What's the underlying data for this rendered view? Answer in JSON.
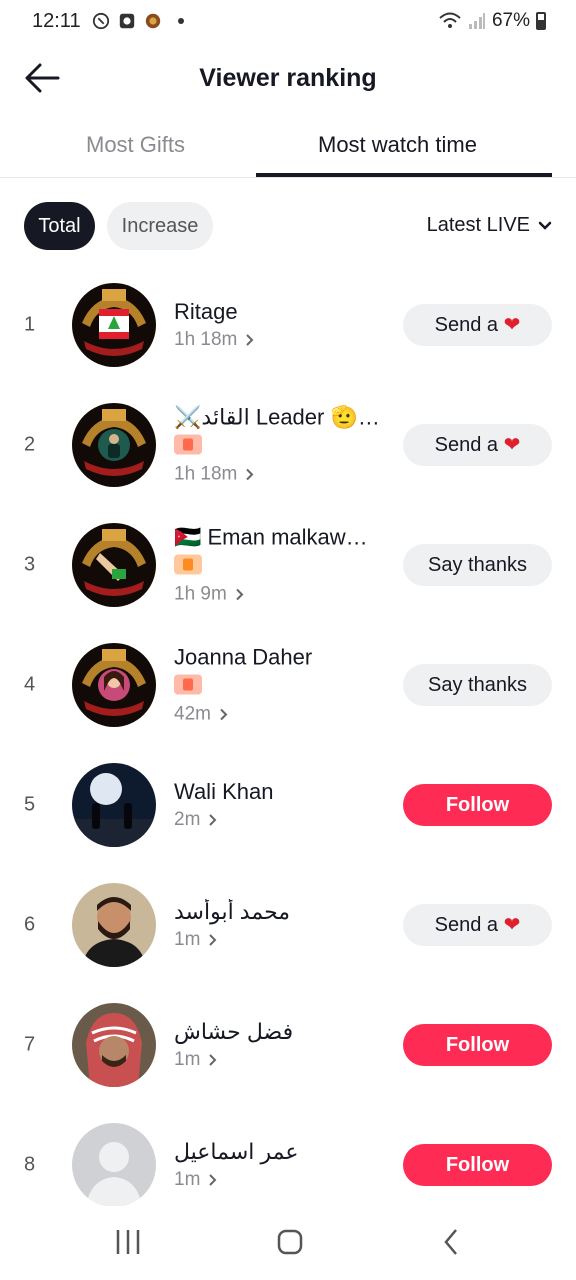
{
  "status": {
    "time": "12:11",
    "battery": "67%"
  },
  "header": {
    "title": "Viewer ranking"
  },
  "tabs": [
    {
      "label": "Most Gifts"
    },
    {
      "label": "Most watch time"
    }
  ],
  "filters": {
    "total": "Total",
    "increase": "Increase",
    "dropdown": "Latest LIVE"
  },
  "rows": [
    {
      "rank": "1",
      "name": "Ritage",
      "time": "1h 18m",
      "action": "Send a",
      "action_heart": "❤",
      "avatar": "crest-lebanon"
    },
    {
      "rank": "2",
      "name": "⚔️القائد Leader 🫡…",
      "time": "1h 18m",
      "action": "Send a",
      "action_heart": "❤",
      "avatar": "crest-man"
    },
    {
      "rank": "3",
      "name": "🇯🇴 Eman malkaw…",
      "time": "1h 9m",
      "action": "Say thanks",
      "avatar": "crest-hand"
    },
    {
      "rank": "4",
      "name": "Joanna Daher",
      "time": "42m",
      "action": "Say thanks",
      "avatar": "crest-woman"
    },
    {
      "rank": "5",
      "name": "Wali Khan",
      "time": "2m",
      "action": "Follow",
      "avatar": "moon-night"
    },
    {
      "rank": "6",
      "name": "محمد أبوأسد",
      "time": "1m",
      "action": "Send a",
      "action_heart": "❤",
      "avatar": "man-beard"
    },
    {
      "rank": "7",
      "name": "فضل حشاش",
      "time": "1m",
      "action": "Follow",
      "avatar": "man-keffiyeh"
    },
    {
      "rank": "8",
      "name": "عمر اسماعيل",
      "time": "1m",
      "action": "Follow",
      "avatar": "default-user"
    }
  ],
  "colors": {
    "follow": "#fe2c55",
    "chip_active": "#161823",
    "chip_idle": "#eff0f1"
  }
}
